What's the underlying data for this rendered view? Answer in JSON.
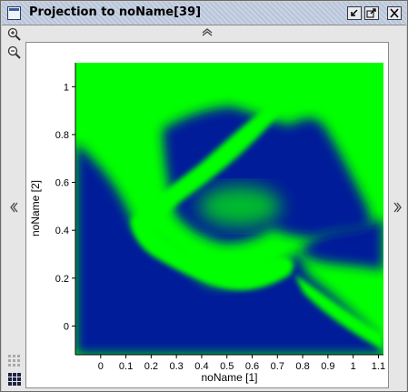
{
  "window": {
    "title": "Projection to noName[39]",
    "icons": [
      "window-icon",
      "minimize-icon",
      "maximize-icon",
      "close-icon"
    ]
  },
  "toolbar": {
    "zoom_in_icon": "zoom-in-icon",
    "zoom_out_icon": "zoom-out-icon",
    "nav_up_icon": "chevron-up-icon",
    "nav_down_icon": "chevron-down-icon",
    "nav_left_icon": "chevron-left-icon",
    "nav_right_icon": "chevron-right-icon",
    "grid_icons": [
      "grid-light-icon",
      "grid-dark-icon"
    ]
  },
  "colors": {
    "field_green": "#00ff00",
    "field_blue": "#001a99"
  },
  "chart_data": {
    "type": "heatmap",
    "xlabel": "noName [1]",
    "ylabel": "noName [2]",
    "xlim": [
      -0.1,
      1.12
    ],
    "ylim": [
      -0.12,
      1.1
    ],
    "x_ticks": [
      "0",
      "0.1",
      "0.2",
      "0.3",
      "0.4",
      "0.5",
      "0.6",
      "0.7",
      "0.8",
      "0.9",
      "1",
      "1.1"
    ],
    "y_ticks": [
      "0",
      "0.2",
      "0.4",
      "0.6",
      "0.8",
      "1"
    ],
    "colormap": [
      "#001a99",
      "#00ff00"
    ],
    "grid": false,
    "legend": "none"
  }
}
